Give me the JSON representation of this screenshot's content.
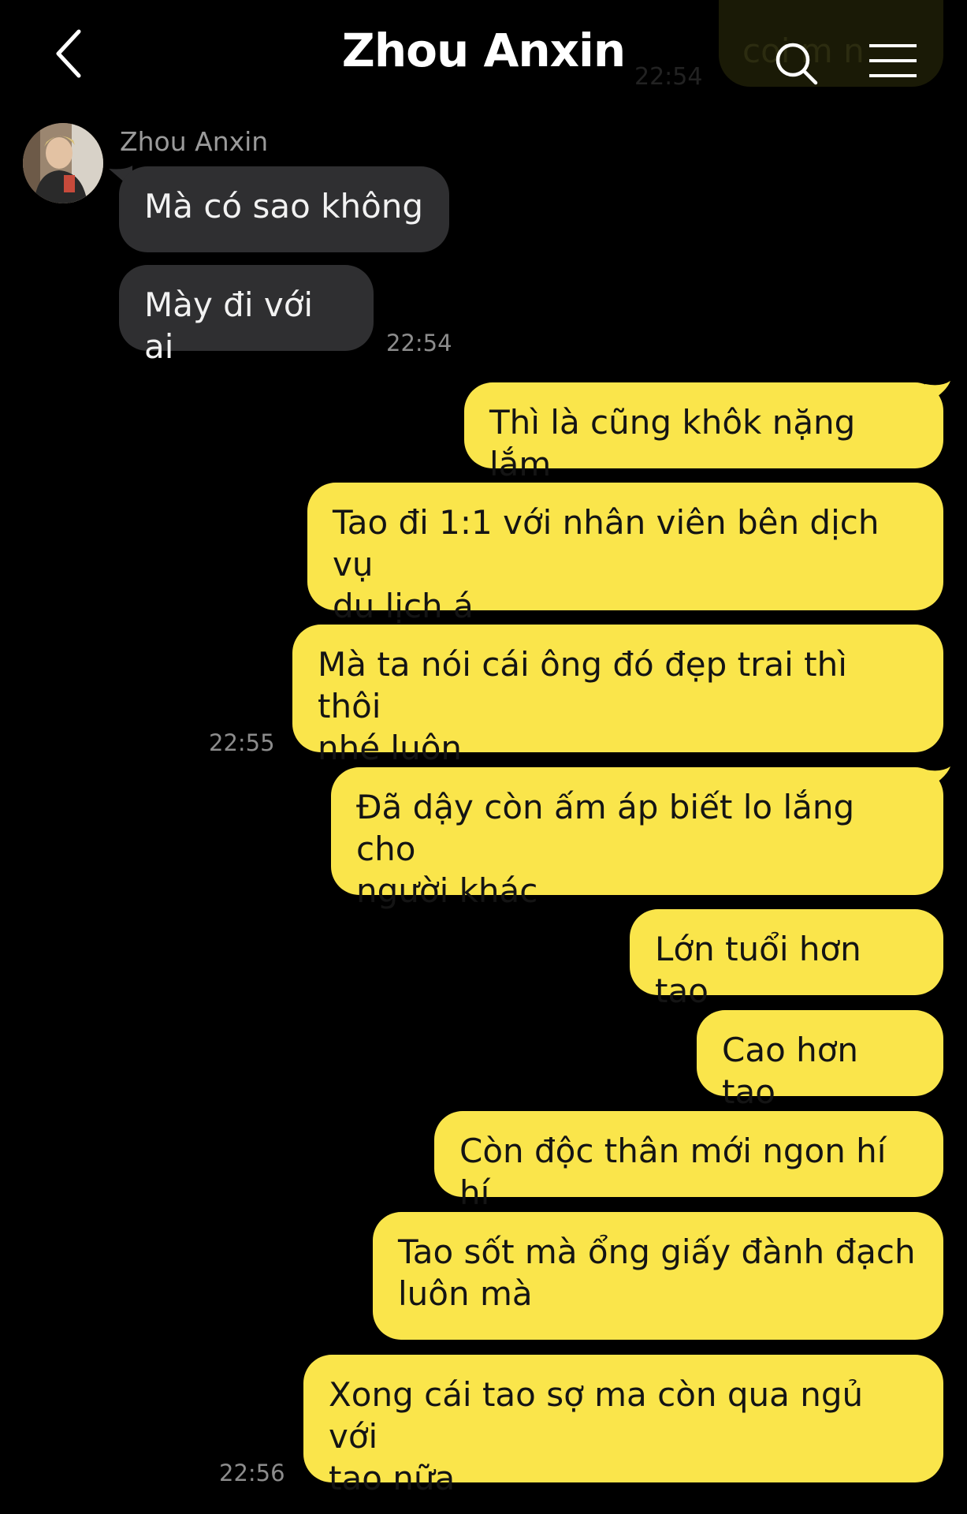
{
  "header": {
    "title": "Zhou Anxin",
    "back_icon": "chevron-left-icon",
    "search_icon": "search-icon",
    "menu_icon": "hamburger-menu-icon",
    "background_peek_text": "coi m n",
    "background_peek_time": "22:54"
  },
  "colors": {
    "background": "#000000",
    "incoming_bubble": "#2f2f31",
    "outgoing_bubble": "#fae54b",
    "timestamp": "#8c8c8c"
  },
  "sender": {
    "name": "Zhou Anxin"
  },
  "messages": [
    {
      "direction": "in",
      "text": "Mà có sao không"
    },
    {
      "direction": "in",
      "text": "Mày đi với ai",
      "time": "22:54"
    },
    {
      "direction": "out",
      "text": "Thì là cũng khôk nặng lắm"
    },
    {
      "direction": "out",
      "line1": "Tao đi 1:1 với nhân viên bên dịch vụ",
      "line2": "du lịch á"
    },
    {
      "direction": "out",
      "line1": "Mà ta nói cái ông đó đẹp trai thì thôi",
      "line2": "nhé luôn",
      "time": "22:55"
    },
    {
      "direction": "out",
      "line1": "Đã dậy còn ấm áp biết lo lắng cho",
      "line2": "người khác"
    },
    {
      "direction": "out",
      "text": "Lớn tuổi hơn tao"
    },
    {
      "direction": "out",
      "text": "Cao hơn tao"
    },
    {
      "direction": "out",
      "text": "Còn độc thân mới ngon hí hí"
    },
    {
      "direction": "out",
      "line1": "Tao sốt mà ổng giấy đành đạch",
      "line2": "luôn mà"
    },
    {
      "direction": "out",
      "line1": "Xong cái tao sợ ma còn qua ngủ với",
      "line2": "tao nữa",
      "time": "22:56"
    }
  ]
}
